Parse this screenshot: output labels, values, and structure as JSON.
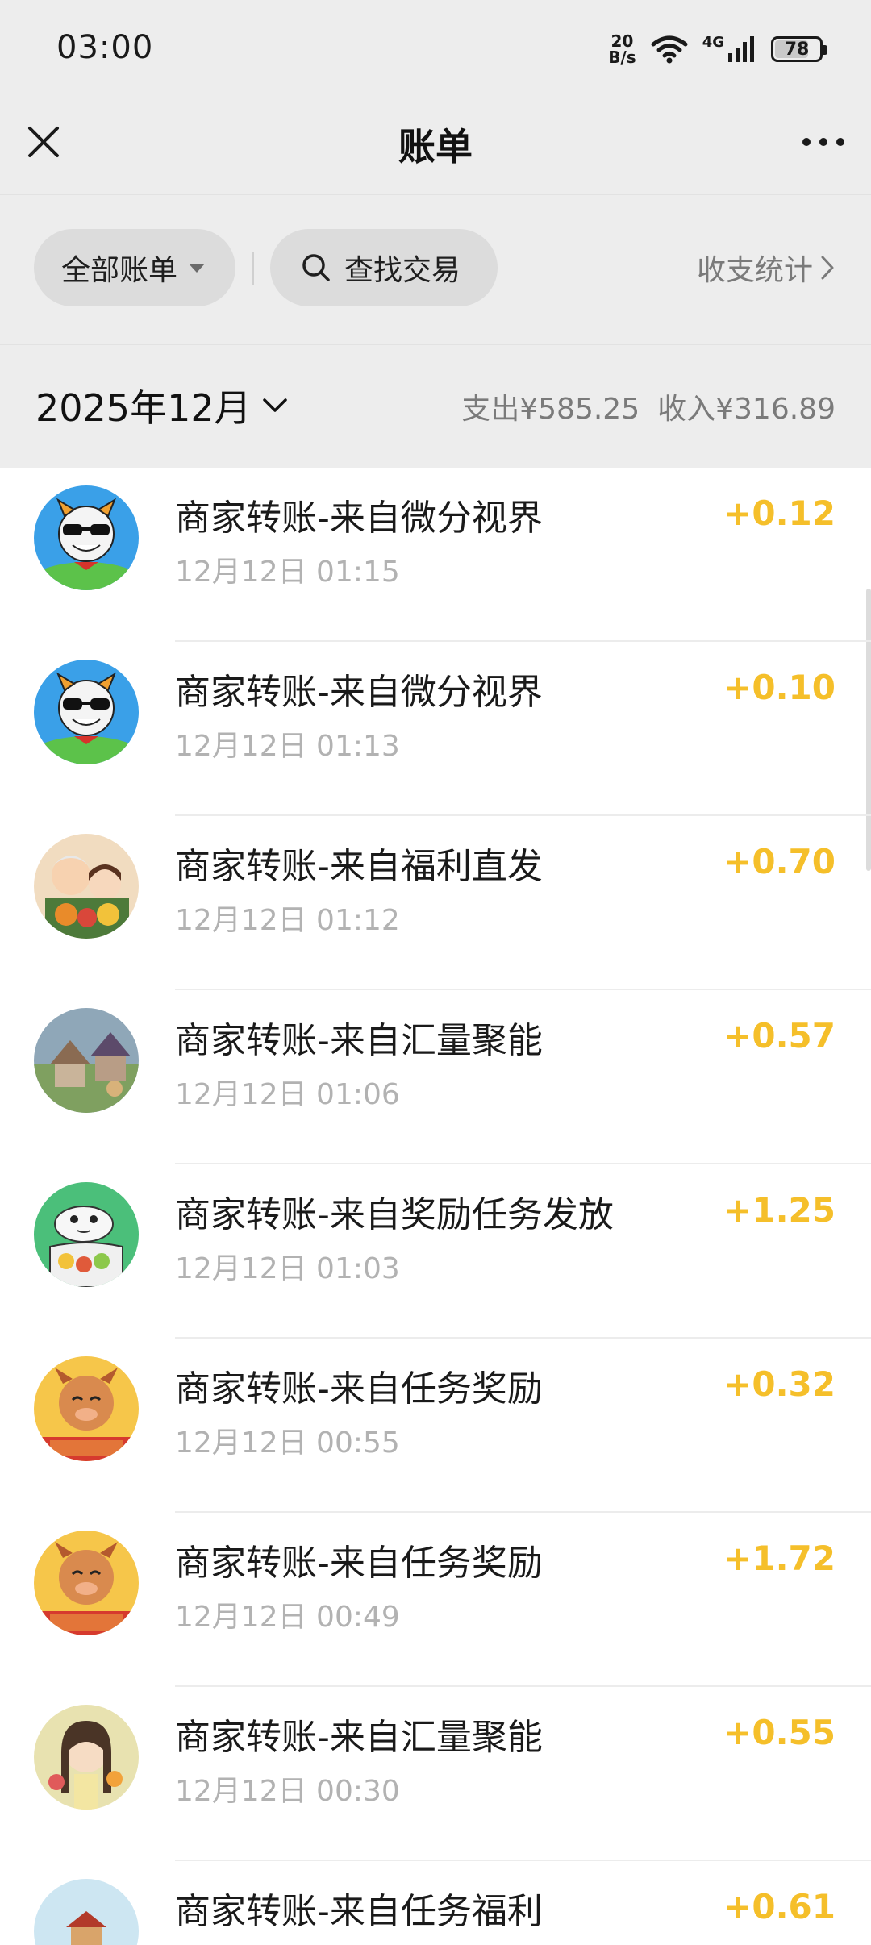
{
  "status_bar": {
    "time": "03:00",
    "net_speed_value": "20",
    "net_speed_unit": "B/s",
    "network_label": "4G",
    "battery": "78",
    "battery_level": 0.78
  },
  "nav": {
    "title": "账单",
    "close_icon": "close-icon",
    "more_icon": "more-icon"
  },
  "filters": {
    "all_bills_label": "全部账单",
    "search_label": "查找交易",
    "stats_label": "收支统计"
  },
  "month": {
    "label": "2025年12月",
    "expense": "支出¥585.25",
    "income": "收入¥316.89"
  },
  "colors": {
    "income_amount": "#f5bf2a",
    "page_bg": "#ededed"
  },
  "transactions": [
    {
      "title": "商家转账-来自微分视界",
      "time": "12月12日 01:15",
      "amount": "+0.12",
      "avatar": "cartoon-dog-sunglasses"
    },
    {
      "title": "商家转账-来自微分视界",
      "time": "12月12日 01:13",
      "amount": "+0.10",
      "avatar": "cartoon-dog-sunglasses"
    },
    {
      "title": "商家转账-来自福利直发",
      "time": "12月12日 01:12",
      "amount": "+0.70",
      "avatar": "grandma-and-girl"
    },
    {
      "title": "商家转账-来自汇量聚能",
      "time": "12月12日 01:06",
      "amount": "+0.57",
      "avatar": "village-scene"
    },
    {
      "title": "商家转账-来自奖励任务发放",
      "time": "12月12日 01:03",
      "amount": "+1.25",
      "avatar": "cartoon-seal"
    },
    {
      "title": "商家转账-来自任务奖励",
      "time": "12月12日 00:55",
      "amount": "+0.32",
      "avatar": "cartoon-dragon"
    },
    {
      "title": "商家转账-来自任务奖励",
      "time": "12月12日 00:49",
      "amount": "+1.72",
      "avatar": "cartoon-dragon"
    },
    {
      "title": "商家转账-来自汇量聚能",
      "time": "12月12日 00:30",
      "amount": "+0.55",
      "avatar": "girl-with-flowers"
    },
    {
      "title": "商家转账-来自任务福利",
      "time": "",
      "amount": "+0.61",
      "avatar": "town-pagoda"
    }
  ]
}
